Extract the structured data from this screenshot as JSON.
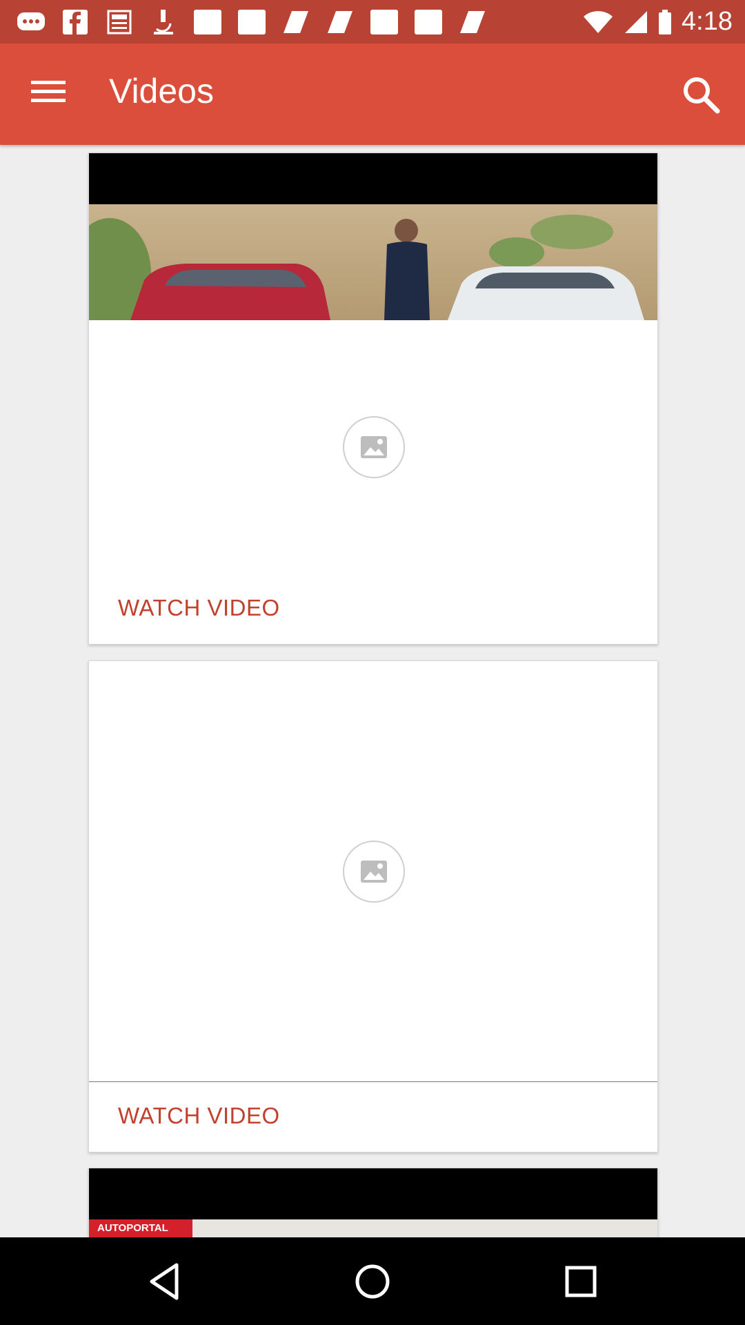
{
  "status_bar": {
    "notification_icons": [
      "chat-bubble-icon",
      "facebook-icon",
      "newspaper-icon",
      "microscope-icon",
      "blank-notification-icon",
      "blank-notification-icon",
      "flag-icon",
      "flag-icon",
      "blank-notification-icon",
      "blank-notification-icon",
      "flag-icon"
    ],
    "time": "4:18"
  },
  "app_bar": {
    "title": "Videos",
    "menu_icon": "hamburger-menu-icon",
    "search_icon": "search-icon",
    "color": "#dc4e3c"
  },
  "cards": [
    {
      "action_label": "WATCH VIDEO"
    },
    {
      "action_label": "WATCH VIDEO"
    },
    {
      "banner_text": "AUTOPORTAL"
    }
  ],
  "nav_bar": {
    "items": [
      "back-icon",
      "home-icon",
      "recents-icon"
    ]
  },
  "colors": {
    "accent": "#dc4e3c",
    "status_bar": "#b84233",
    "action_text": "#c2402e"
  }
}
